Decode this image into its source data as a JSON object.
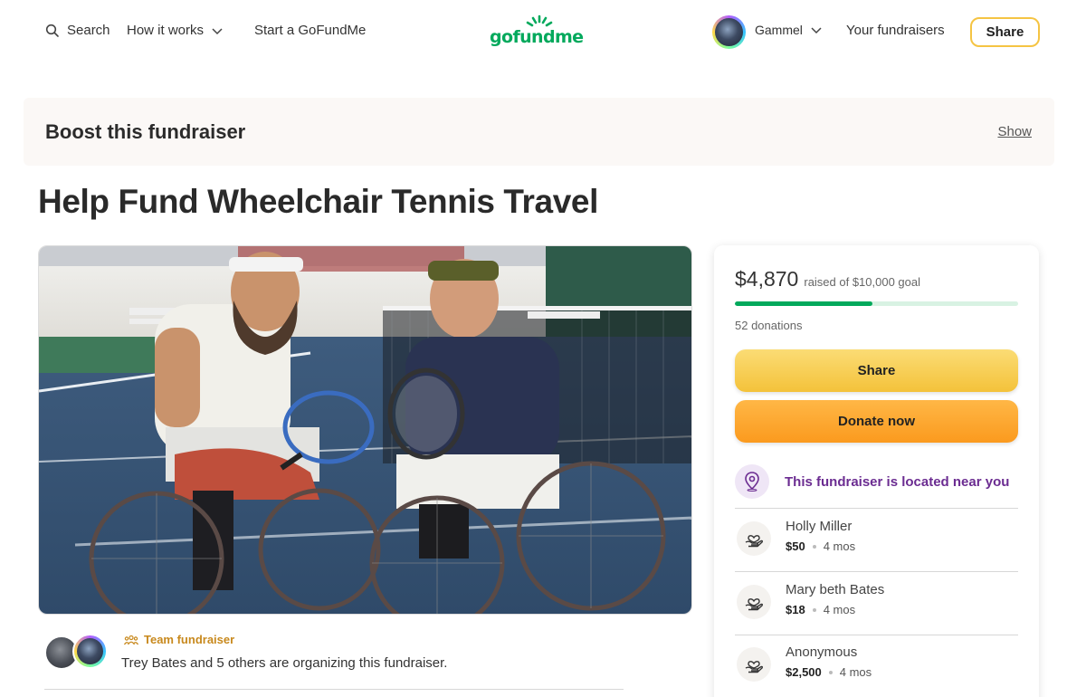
{
  "header": {
    "search_label": "Search",
    "how_it_works_label": "How it works",
    "start_label": "Start a GoFundMe",
    "logo_text": "gofundme",
    "username": "Gammel",
    "your_fundraisers_label": "Your fundraisers",
    "share_label": "Share"
  },
  "boost": {
    "title": "Boost this fundraiser",
    "show_label": "Show"
  },
  "campaign": {
    "title": "Help Fund Wheelchair Tennis Travel"
  },
  "organizer": {
    "tag": "Team fundraiser",
    "text": "Trey Bates and 5 others are organizing this fundraiser."
  },
  "donation_card": {
    "raised_amount": "$4,870",
    "raised_goal_text": "raised of $10,000 goal",
    "progress_fraction": 0.487,
    "donations_count": "52 donations",
    "share_label": "Share",
    "donate_label": "Donate now",
    "nearby_text": "This fundraiser is located near you",
    "donors": [
      {
        "name": "Holly Miller",
        "amount": "$50",
        "time": "4 mos"
      },
      {
        "name": "Mary beth Bates",
        "amount": "$18",
        "time": "4 mos"
      },
      {
        "name": "Anonymous",
        "amount": "$2,500",
        "time": "4 mos"
      }
    ]
  },
  "colors": {
    "brand_green": "#02a95c",
    "share_yellow": "#f4c23a",
    "donate_orange": "#fb9a1e",
    "nearby_purple": "#6b2c91",
    "team_gold": "#c8891d"
  },
  "icons": [
    "search-icon",
    "chevron-down-icon",
    "map-pin-icon",
    "heart-hand-icon",
    "team-icon"
  ]
}
